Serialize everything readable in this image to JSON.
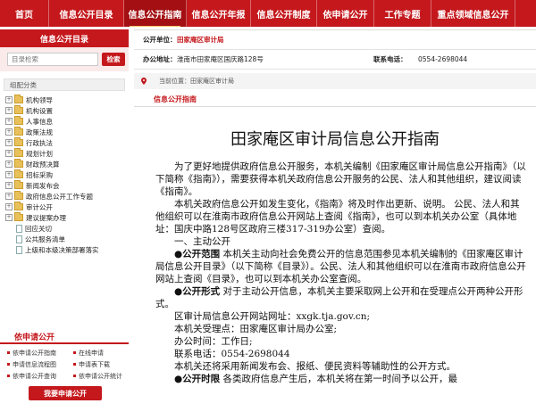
{
  "nav": {
    "items": [
      "首页",
      "信息公开目录",
      "信息公开指南",
      "信息公开年报",
      "信息公开制度",
      "依申请公开",
      "工作专题",
      "重点领域信息公开"
    ],
    "active_index": 2
  },
  "sidebar": {
    "catalog_title": "信息公开目录",
    "search_placeholder": "目录检索",
    "search_button": "检索",
    "category_header": "组配分类",
    "tree": [
      {
        "label": "机构领导",
        "level": 0
      },
      {
        "label": "机构设置",
        "level": 0
      },
      {
        "label": "人事信息",
        "level": 0
      },
      {
        "label": "政策法规",
        "level": 0
      },
      {
        "label": "行政执法",
        "level": 0
      },
      {
        "label": "规划计划",
        "level": 0
      },
      {
        "label": "财政预决算",
        "level": 0
      },
      {
        "label": "招标采购",
        "level": 0
      },
      {
        "label": "新闻发布会",
        "level": 0
      },
      {
        "label": "政府信息公开工作专题",
        "level": 0
      },
      {
        "label": "审计公开",
        "level": 0
      },
      {
        "label": "建议提案办理",
        "level": 0
      },
      {
        "label": "回应关切",
        "level": 1
      },
      {
        "label": "公共服务清单",
        "level": 1
      },
      {
        "label": "上级和本级决策部署落实",
        "level": 1
      }
    ],
    "apply": {
      "title": "依申请公开",
      "links": [
        "依申请公开指南",
        "在线申请",
        "申请信息流程图",
        "申请表下载",
        "依申请公开查询",
        "依申请公开统计"
      ],
      "button": "我要申请公开"
    }
  },
  "info": {
    "unit_label": "公开单位：",
    "unit_value": "田家庵区审计局",
    "address_label": "办公地址：",
    "address_value": "淮南市田家庵区国庆路128号",
    "phone_label": "联系电话：",
    "phone_value": "0554-2698044"
  },
  "breadcrumb": {
    "prefix": "当前位置：",
    "path": "田家庵区审计局"
  },
  "section_tab": "信息公开指南",
  "document": {
    "title": "田家庵区审计局信息公开指南",
    "para1": "为了更好地提供政府信息公开服务，本机关编制《田家庵区审计局信息公开指南》（以下简称《指南》），需要获得本机关政府信息公开服务的公民、法人和其他组织，建议阅读《指南》。",
    "para2": "本机关政府信息公开如发生变化，《指南》将及时作出更新、说明。 公民、法人和其他组织可以在淮南市政府信息公开网站上查阅《指南》，也可以到本机关办公室（具体地址：国庆中路128号区政府三楼317-319办公室）查阅。",
    "heading1": "一、主动公开",
    "scope_label": "●公开范围",
    "scope_text": " 本机关主动向社会免费公开的信息范围参见本机关编制的《田家庵区审计局信息公开目录》（以下简称《目录》）。公民、法人和其他组织可以在淮南市政府信息公开网站上查阅《目录》，也可以到本机关办公室查阅。",
    "form_label": "●公开形式",
    "form_text": " 对于主动公开信息，本机关主要采取网上公开和在受理点公开两种公开形式。",
    "site_line": "区审计局信息公开网站网址：xxgk.tja.gov.cn;",
    "office_line": "本机关受理点：田家庵区审计局办公室;",
    "hours_line": "办公时间：工作日;",
    "phone_line": "联系电话：0554-2698044",
    "media_line": "本机关还将采用新闻发布会、报纸、便民资料等辅助性的公开方式。",
    "time_label": "●公开时限",
    "time_text": " 各类政府信息产生后，本机关将在第一时间予以公开，最"
  },
  "colors": {
    "brand_red": "#c4181c",
    "nav_active": "#a30f12"
  }
}
